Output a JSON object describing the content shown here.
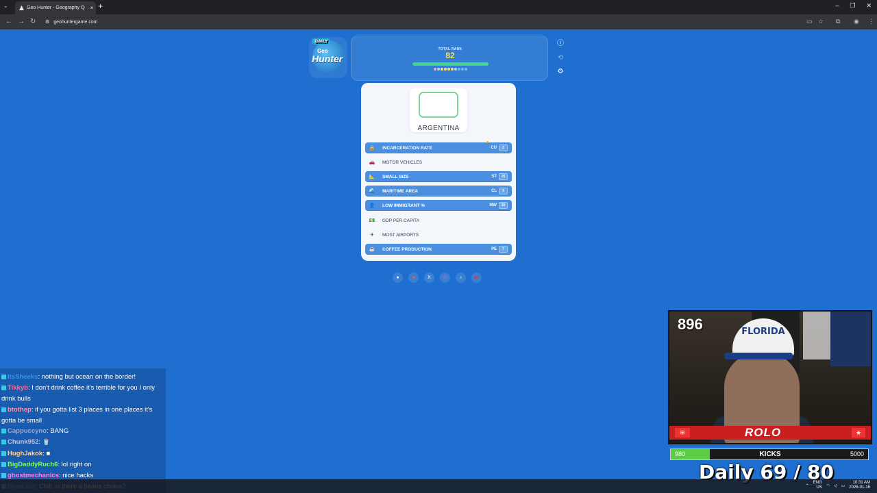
{
  "browser": {
    "tab_title": "Geo Hunter - Geography Quiz",
    "tab_close": "×",
    "new_tab": "+",
    "tab_menu": "⌄",
    "url": "geohuntergame.com",
    "win_min": "–",
    "win_max": "❐",
    "win_close": "✕"
  },
  "header": {
    "logo_daily": "DAILY",
    "logo_geo": "Geo",
    "logo_hunter": "Hunter",
    "rank_label": "TOTAL RANK",
    "rank_value": "82",
    "rank_dot_colors": [
      "#f4a6c7",
      "#a9d9ff",
      "#ffe36a",
      "#ffe36a",
      "#ffe36a",
      "#ffe36a",
      "#a9d9ff",
      "#7fb6ee",
      "#7fb6ee",
      "#7fb6ee"
    ],
    "icons": [
      "info-icon",
      "refresh-icon",
      "settings-icon"
    ]
  },
  "card": {
    "country": "ARGENTINA",
    "categories": [
      {
        "label": "INCARCERATION RATE",
        "code": "CU",
        "score": "2",
        "filled": true,
        "icon": "🔒"
      },
      {
        "label": "MOTOR VEHICLES",
        "code": "",
        "score": "",
        "filled": false,
        "icon": "🚗"
      },
      {
        "label": "SMALL SIZE",
        "code": "ST",
        "score": "25",
        "filled": true,
        "icon": "📐"
      },
      {
        "label": "MARITIME AREA",
        "code": "CL",
        "score": "9",
        "filled": true,
        "icon": "🌊"
      },
      {
        "label": "LOW IMMIGRANT %",
        "code": "MW",
        "score": "30",
        "filled": true,
        "icon": "👤"
      },
      {
        "label": "GDP PER CAPITA",
        "code": "",
        "score": "",
        "filled": false,
        "icon": "💵"
      },
      {
        "label": "MOST AIRPORTS",
        "code": "",
        "score": "",
        "filled": false,
        "icon": "✈"
      },
      {
        "label": "COFFEE PRODUCTION",
        "code": "PE",
        "score": "7",
        "filled": true,
        "icon": "☕"
      }
    ]
  },
  "social": [
    "●",
    "●",
    "X",
    "◎",
    "♪",
    "▶"
  ],
  "chat": [
    {
      "user": "ItsSheeks",
      "color": "#3a8fe8",
      "text": ": nothing but ocean on the border!"
    },
    {
      "user": "Tikkyb",
      "color": "#ff6b9a",
      "text": ": I don't drink coffee it's terrible for you I only drink bulls"
    },
    {
      "user": "btothep",
      "color": "#ff8fb0",
      "text": ": if you gotta list 3 places in one places it's gotta be small"
    },
    {
      "user": "Cappuccyno",
      "color": "#a0a8c0",
      "text": ": BANG"
    },
    {
      "user": "Chunk952",
      "color": "#c0c0d8",
      "text": ": 🥤"
    },
    {
      "user": "HughJakok",
      "color": "#ffd5a0",
      "text": ": ■"
    },
    {
      "user": "BigDaddyRuch6",
      "color": "#7cff5a",
      "text": ": lol right on"
    },
    {
      "user": "ghostmechanics",
      "color": "#ff7de0",
      "text": ": nice hacks"
    },
    {
      "user": "BearL0st",
      "color": "#6aa0ff",
      "text": ": Chill. is there a beans choice?"
    }
  ],
  "stream": {
    "count": "896",
    "hat_text": "FLORIDA",
    "brand": "ROLO",
    "kicks_current": "980",
    "kicks_label": "KICKS",
    "kicks_goal": "5000",
    "kicks_progress": 0.196,
    "daily": "Daily  69 / 80"
  },
  "taskbar": {
    "lang1": "ENG",
    "lang2": "US",
    "time": "10:31 AM",
    "date": "2026-01-16"
  }
}
